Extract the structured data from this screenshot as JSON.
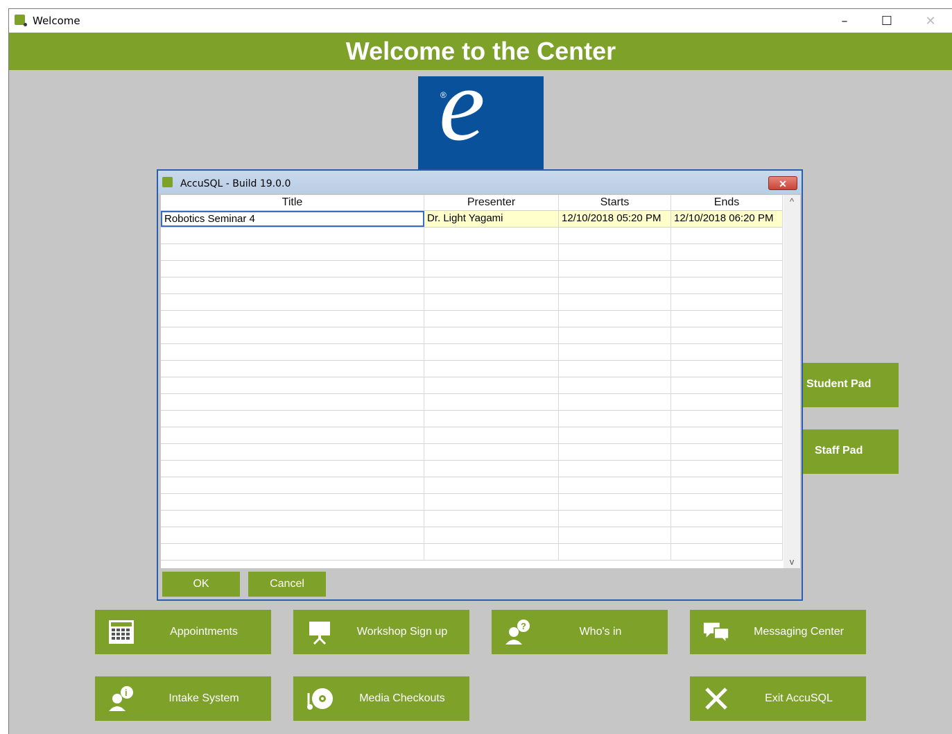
{
  "window": {
    "title": "Welcome",
    "minimize": "–",
    "maximize": "☐",
    "close": "✕"
  },
  "banner": {
    "title": "Welcome to the Center"
  },
  "logo": {
    "letter": "e",
    "mark": "®"
  },
  "side_buttons": {
    "student_pad": "Student Pad",
    "staff_pad": "Staff Pad"
  },
  "dialog": {
    "title": "AccuSQL - Build 19.0.0",
    "close": "✕",
    "columns": [
      "Title",
      "Presenter",
      "Starts",
      "Ends"
    ],
    "rows": [
      {
        "title": "Robotics Seminar 4",
        "presenter": "Dr. Light Yagami",
        "starts": "12/10/2018 05:20 PM",
        "ends": "12/10/2018 06:20 PM"
      }
    ],
    "ok_label": "OK",
    "cancel_label": "Cancel",
    "scroll_up": "^",
    "scroll_down": "v"
  },
  "main_buttons": {
    "appointments": "Appointments",
    "workshop_signup": "Workshop Sign up",
    "whos_in": "Who's in",
    "messaging_center": "Messaging Center",
    "intake_system": "Intake System",
    "media_checkouts": "Media Checkouts",
    "exit": "Exit AccuSQL"
  },
  "colors": {
    "accent_green": "#7ea12a",
    "logo_blue": "#0a519c",
    "background_gray": "#c6c6c6"
  }
}
